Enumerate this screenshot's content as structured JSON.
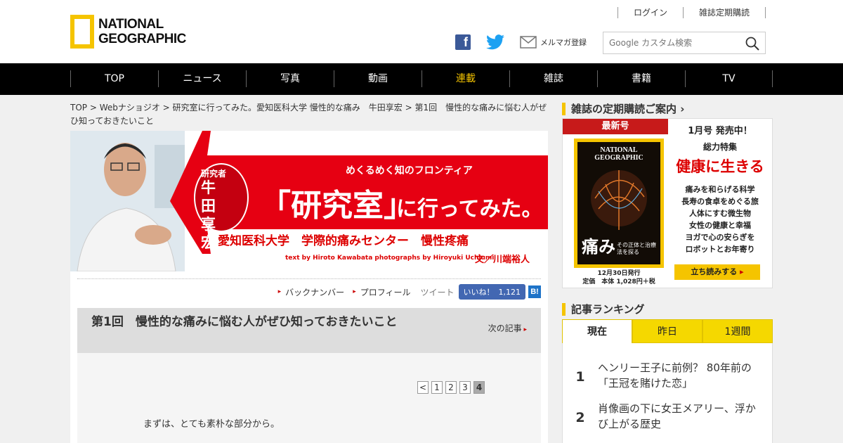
{
  "header": {
    "logo_line1": "NATIONAL",
    "logo_line2": "GEOGRAPHIC",
    "login": "ログイン",
    "subscribe_link": "雑誌定期購読",
    "newsletter": "メルマガ登録",
    "search_placeholder": "Google カスタム検索"
  },
  "nav": [
    "TOP",
    "ニュース",
    "写真",
    "動画",
    "連載",
    "雑誌",
    "書籍",
    "TV"
  ],
  "breadcrumb": "TOP > Webナショジオ > 研究室に行ってみた。愛知医科大学 慢性的な痛み　牛田享宏 > 第1回　慢性的な痛みに悩む人がぜひ知っておきたいこと",
  "banner": {
    "subtitle": "めくるめく知のフロンティア",
    "researcher_label": "研究者",
    "researcher_name": "牛田享宏",
    "title_main": "「研究室」",
    "title_rest": "に行ってみた。",
    "department": "愛知医科大学　学際的痛みセンター　慢性疼痛",
    "credit": "text by Hiroto Kawabata photographs by Hiroyuki Uchiumi",
    "credit_jp": "文／川端裕人"
  },
  "tools": {
    "backnumber": "バックナンバー",
    "profile": "プロフィール",
    "tweet": "ツイート",
    "like": "いいね！",
    "like_count": "1,121",
    "hatena": "B!"
  },
  "article": {
    "title": "第1回　慢性的な痛みに悩む人がぜひ知っておきたいこと",
    "next": "次の記事",
    "pager": [
      "<",
      "1",
      "2",
      "3",
      "4"
    ],
    "pager_current": "4",
    "intro": "まずは、とても素朴な部分から。"
  },
  "sidebar": {
    "subscribe_heading": "雑誌の定期購読ご案内",
    "latest_tag": "最新号",
    "mag_brand": "NATIONAL GEOGRAPHIC",
    "mag_cover_title": "痛み",
    "mag_cover_sub": "その正体と治療法を探る",
    "release_date": "12月30日発行",
    "price": "定価　本体 1,028円＋税",
    "issue": "1月号 発売中！",
    "feature_label": "総力特集",
    "feature_title": "健康に生きる",
    "features": [
      "痛みを和らげる科学",
      "長寿の食卓をめぐる旅",
      "人体にすむ微生物",
      "女性の健康と幸福",
      "ヨガで心の安らぎを",
      "ロボットとお年寄り"
    ],
    "read_button": "立ち読みする",
    "ranking_heading": "記事ランキング",
    "ranking_tabs": [
      "現在",
      "昨日",
      "1週間"
    ],
    "ranking": [
      {
        "no": "1",
        "title": "ヘンリー王子に前例？ 80年前の「王冠を賭けた恋」"
      },
      {
        "no": "2",
        "title": "肖像画の下に女王メアリー、浮かび上がる歴史"
      }
    ]
  },
  "colors": {
    "accent": "#f5c400",
    "banner_red": "#e60012",
    "nav_bg": "#000000"
  }
}
